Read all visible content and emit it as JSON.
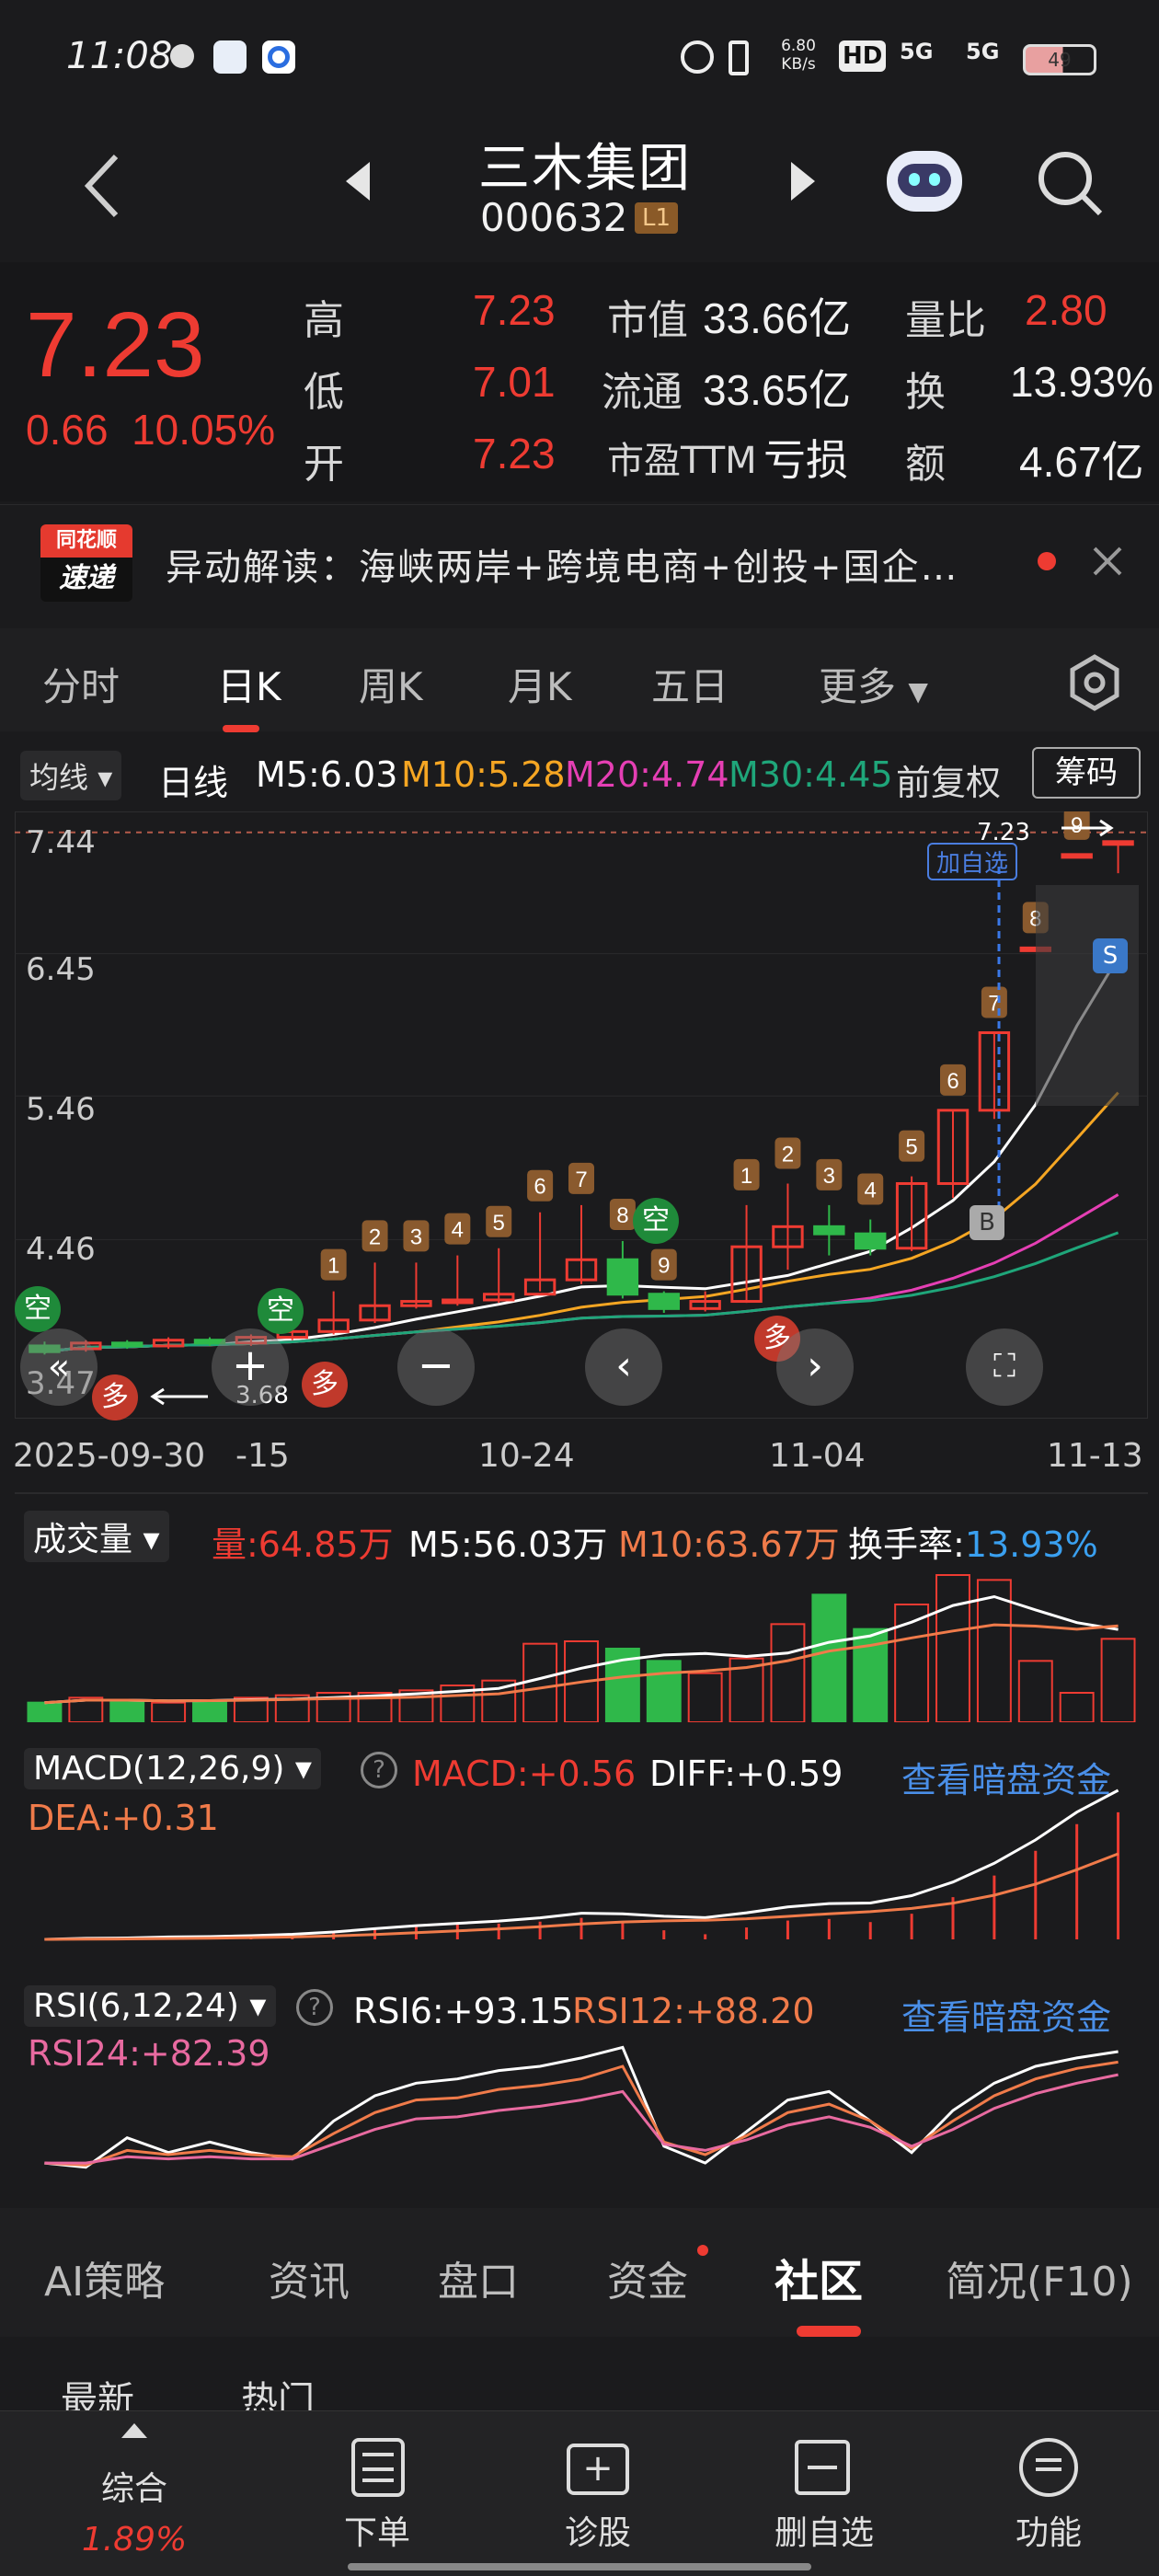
{
  "status": {
    "time": "11:08",
    "net_speed_top": "6.80",
    "net_speed_bottom": "KB/s",
    "hd": "HD",
    "sig1": "5G",
    "sig2": "5G",
    "battery": "49"
  },
  "header": {
    "name": "三木集团",
    "code": "000632",
    "badge": "L1"
  },
  "quote": {
    "price": "7.23",
    "change": "0.66",
    "pct": "10.05%",
    "rows": [
      {
        "l1": "高",
        "v1": "7.23",
        "l2": "市值",
        "v2": "33.66亿",
        "l3": "量比",
        "v3": "2.80"
      },
      {
        "l1": "低",
        "v1": "7.01",
        "l2": "流通",
        "v2": "33.65亿",
        "l3": "换",
        "v3": "13.93%"
      },
      {
        "l1": "开",
        "v1": "7.23",
        "l2": "市盈TTM",
        "v2": "亏损",
        "l3": "额",
        "v3": "4.67亿"
      }
    ]
  },
  "news": {
    "logo_top": "同花顺",
    "logo_bottom": "速递",
    "text": "异动解读：海峡两岸+跨境电商+创投+国企…"
  },
  "period_tabs": [
    "分时",
    "日K",
    "周K",
    "月K",
    "五日",
    "更多"
  ],
  "ma": {
    "selector": "均线",
    "period": "日线",
    "m5": "M5:6.03",
    "m10": "M10:5.28",
    "m20": "M20:4.74",
    "m30": "M30:4.45",
    "adj": "前复权",
    "chips": "筹码"
  },
  "kline": {
    "y_ticks": [
      "7.44",
      "6.45",
      "5.46",
      "4.46",
      "3.47"
    ],
    "x_ticks": [
      "2025-09-30",
      "-15",
      "10-24",
      "11-04",
      "11-13"
    ],
    "high_label": "7.23",
    "low_label": "3.68",
    "add_watch": "加自选",
    "markers": {
      "kong": "空",
      "duo": "多",
      "sell": "S",
      "buy": "B"
    },
    "count_labels": [
      "1",
      "2",
      "3",
      "4",
      "5",
      "6",
      "7",
      "8",
      "9",
      "1",
      "2",
      "3",
      "4",
      "5",
      "6",
      "7",
      "8",
      "9"
    ]
  },
  "chart_data": {
    "type": "candlestick",
    "candles": [
      {
        "o": 3.72,
        "c": 3.68,
        "h": 3.75,
        "l": 3.66
      },
      {
        "o": 3.7,
        "c": 3.74,
        "h": 3.76,
        "l": 3.68
      },
      {
        "o": 3.74,
        "c": 3.72,
        "h": 3.76,
        "l": 3.7
      },
      {
        "o": 3.72,
        "c": 3.76,
        "h": 3.78,
        "l": 3.7
      },
      {
        "o": 3.76,
        "c": 3.74,
        "h": 3.78,
        "l": 3.72
      },
      {
        "o": 3.74,
        "c": 3.78,
        "h": 3.8,
        "l": 3.72
      },
      {
        "o": 3.78,
        "c": 3.82,
        "h": 4.05,
        "l": 3.76
      },
      {
        "o": 3.82,
        "c": 3.9,
        "h": 4.1,
        "l": 3.8
      },
      {
        "o": 3.9,
        "c": 4.0,
        "h": 4.3,
        "l": 3.88
      },
      {
        "o": 4.0,
        "c": 4.03,
        "h": 4.3,
        "l": 3.98
      },
      {
        "o": 4.03,
        "c": 4.04,
        "h": 4.35,
        "l": 4.0
      },
      {
        "o": 4.04,
        "c": 4.08,
        "h": 4.4,
        "l": 4.02
      },
      {
        "o": 4.08,
        "c": 4.18,
        "h": 4.65,
        "l": 4.1
      },
      {
        "o": 4.18,
        "c": 4.32,
        "h": 4.7,
        "l": 4.15
      },
      {
        "o": 4.32,
        "c": 4.08,
        "h": 4.45,
        "l": 4.05
      },
      {
        "o": 4.08,
        "c": 3.98,
        "h": 4.1,
        "l": 3.95
      },
      {
        "o": 3.98,
        "c": 4.03,
        "h": 4.1,
        "l": 3.96
      },
      {
        "o": 4.03,
        "c": 4.41,
        "h": 4.7,
        "l": 4.02
      },
      {
        "o": 4.41,
        "c": 4.55,
        "h": 4.85,
        "l": 4.25
      },
      {
        "o": 4.55,
        "c": 4.5,
        "h": 4.7,
        "l": 4.35
      },
      {
        "o": 4.5,
        "c": 4.4,
        "h": 4.6,
        "l": 4.35
      },
      {
        "o": 4.4,
        "c": 4.85,
        "h": 4.9,
        "l": 4.38
      },
      {
        "o": 4.85,
        "c": 5.36,
        "h": 5.36,
        "l": 4.75
      },
      {
        "o": 5.36,
        "c": 5.9,
        "h": 5.9,
        "l": 5.3
      },
      {
        "o": 6.49,
        "c": 6.49,
        "h": 6.49,
        "l": 6.49
      },
      {
        "o": 7.14,
        "c": 7.14,
        "h": 7.14,
        "l": 7.14
      },
      {
        "o": 7.23,
        "c": 7.23,
        "h": 7.23,
        "l": 7.01
      }
    ],
    "volume": {
      "title": "成交量",
      "vol": "量:64.85万",
      "m5": "M5:56.03万",
      "m10": "M10:63.67万",
      "turnover_label": "换手率:",
      "turnover": "13.93%"
    },
    "volume_values": [
      8,
      10,
      9,
      8,
      9,
      10,
      11,
      12,
      12,
      13,
      15,
      17,
      32,
      33,
      30,
      25,
      20,
      26,
      40,
      52,
      38,
      48,
      60,
      58,
      25,
      12,
      34
    ],
    "macd": {
      "title": "MACD(12,26,9)",
      "macd": "MACD:+0.56",
      "diff": "DIFF:+0.59",
      "dea": "DEA:+0.31",
      "link": "查看暗盘资金"
    },
    "rsi": {
      "title": "RSI(6,12,24)",
      "rsi6": "RSI6:+93.15",
      "rsi12": "RSI12:+88.20",
      "rsi24": "RSI24:+82.39",
      "link": "查看暗盘资金"
    },
    "rsi6_values": [
      40,
      38,
      52,
      45,
      50,
      45,
      42,
      60,
      72,
      78,
      80,
      84,
      86,
      90,
      95,
      48,
      40,
      55,
      70,
      74,
      60,
      45,
      65,
      78,
      86,
      90,
      93
    ],
    "rsi12_values": [
      40,
      39,
      46,
      44,
      46,
      44,
      43,
      54,
      64,
      70,
      71,
      75,
      77,
      80,
      86,
      50,
      44,
      53,
      64,
      68,
      60,
      47,
      60,
      72,
      80,
      85,
      88
    ],
    "rsi24_values": [
      40,
      40,
      43,
      42,
      43,
      42,
      42,
      49,
      56,
      61,
      62,
      65,
      67,
      70,
      74,
      49,
      46,
      51,
      58,
      62,
      57,
      48,
      56,
      66,
      73,
      78,
      82
    ]
  },
  "bottom_tabs": [
    "AI策略",
    "资讯",
    "盘口",
    "资金",
    "社区",
    "简况(F10)"
  ],
  "sub_tabs": [
    "最新",
    "热门"
  ],
  "navbar": [
    {
      "label": "综合",
      "sub": "1.89%"
    },
    {
      "label": "下单",
      "sub": ""
    },
    {
      "label": "诊股",
      "sub": ""
    },
    {
      "label": "删自选",
      "sub": ""
    },
    {
      "label": "功能",
      "sub": ""
    }
  ]
}
